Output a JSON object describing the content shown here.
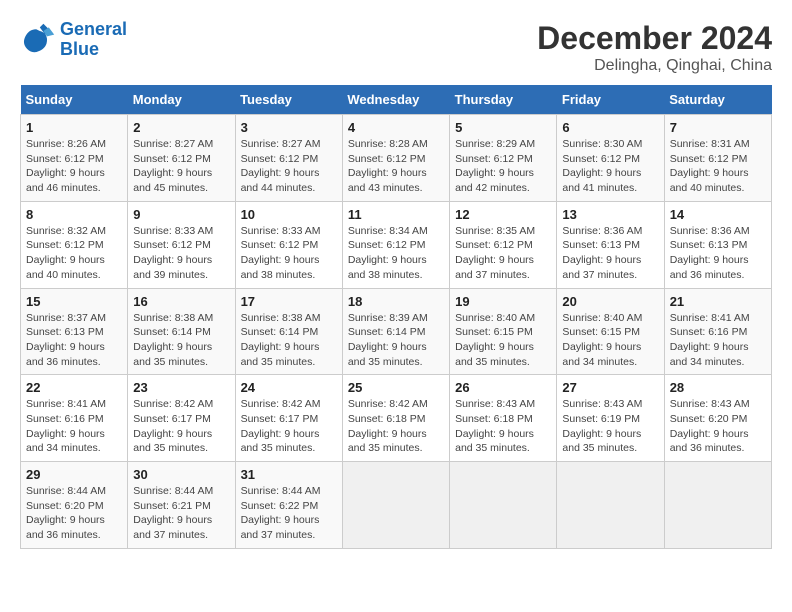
{
  "header": {
    "logo_line1": "General",
    "logo_line2": "Blue",
    "month": "December 2024",
    "location": "Delingha, Qinghai, China"
  },
  "weekdays": [
    "Sunday",
    "Monday",
    "Tuesday",
    "Wednesday",
    "Thursday",
    "Friday",
    "Saturday"
  ],
  "weeks": [
    [
      {
        "day": "1",
        "sunrise": "8:26 AM",
        "sunset": "6:12 PM",
        "daylight": "9 hours and 46 minutes."
      },
      {
        "day": "2",
        "sunrise": "8:27 AM",
        "sunset": "6:12 PM",
        "daylight": "9 hours and 45 minutes."
      },
      {
        "day": "3",
        "sunrise": "8:27 AM",
        "sunset": "6:12 PM",
        "daylight": "9 hours and 44 minutes."
      },
      {
        "day": "4",
        "sunrise": "8:28 AM",
        "sunset": "6:12 PM",
        "daylight": "9 hours and 43 minutes."
      },
      {
        "day": "5",
        "sunrise": "8:29 AM",
        "sunset": "6:12 PM",
        "daylight": "9 hours and 42 minutes."
      },
      {
        "day": "6",
        "sunrise": "8:30 AM",
        "sunset": "6:12 PM",
        "daylight": "9 hours and 41 minutes."
      },
      {
        "day": "7",
        "sunrise": "8:31 AM",
        "sunset": "6:12 PM",
        "daylight": "9 hours and 40 minutes."
      }
    ],
    [
      {
        "day": "8",
        "sunrise": "8:32 AM",
        "sunset": "6:12 PM",
        "daylight": "9 hours and 40 minutes."
      },
      {
        "day": "9",
        "sunrise": "8:33 AM",
        "sunset": "6:12 PM",
        "daylight": "9 hours and 39 minutes."
      },
      {
        "day": "10",
        "sunrise": "8:33 AM",
        "sunset": "6:12 PM",
        "daylight": "9 hours and 38 minutes."
      },
      {
        "day": "11",
        "sunrise": "8:34 AM",
        "sunset": "6:12 PM",
        "daylight": "9 hours and 38 minutes."
      },
      {
        "day": "12",
        "sunrise": "8:35 AM",
        "sunset": "6:12 PM",
        "daylight": "9 hours and 37 minutes."
      },
      {
        "day": "13",
        "sunrise": "8:36 AM",
        "sunset": "6:13 PM",
        "daylight": "9 hours and 37 minutes."
      },
      {
        "day": "14",
        "sunrise": "8:36 AM",
        "sunset": "6:13 PM",
        "daylight": "9 hours and 36 minutes."
      }
    ],
    [
      {
        "day": "15",
        "sunrise": "8:37 AM",
        "sunset": "6:13 PM",
        "daylight": "9 hours and 36 minutes."
      },
      {
        "day": "16",
        "sunrise": "8:38 AM",
        "sunset": "6:14 PM",
        "daylight": "9 hours and 35 minutes."
      },
      {
        "day": "17",
        "sunrise": "8:38 AM",
        "sunset": "6:14 PM",
        "daylight": "9 hours and 35 minutes."
      },
      {
        "day": "18",
        "sunrise": "8:39 AM",
        "sunset": "6:14 PM",
        "daylight": "9 hours and 35 minutes."
      },
      {
        "day": "19",
        "sunrise": "8:40 AM",
        "sunset": "6:15 PM",
        "daylight": "9 hours and 35 minutes."
      },
      {
        "day": "20",
        "sunrise": "8:40 AM",
        "sunset": "6:15 PM",
        "daylight": "9 hours and 34 minutes."
      },
      {
        "day": "21",
        "sunrise": "8:41 AM",
        "sunset": "6:16 PM",
        "daylight": "9 hours and 34 minutes."
      }
    ],
    [
      {
        "day": "22",
        "sunrise": "8:41 AM",
        "sunset": "6:16 PM",
        "daylight": "9 hours and 34 minutes."
      },
      {
        "day": "23",
        "sunrise": "8:42 AM",
        "sunset": "6:17 PM",
        "daylight": "9 hours and 35 minutes."
      },
      {
        "day": "24",
        "sunrise": "8:42 AM",
        "sunset": "6:17 PM",
        "daylight": "9 hours and 35 minutes."
      },
      {
        "day": "25",
        "sunrise": "8:42 AM",
        "sunset": "6:18 PM",
        "daylight": "9 hours and 35 minutes."
      },
      {
        "day": "26",
        "sunrise": "8:43 AM",
        "sunset": "6:18 PM",
        "daylight": "9 hours and 35 minutes."
      },
      {
        "day": "27",
        "sunrise": "8:43 AM",
        "sunset": "6:19 PM",
        "daylight": "9 hours and 35 minutes."
      },
      {
        "day": "28",
        "sunrise": "8:43 AM",
        "sunset": "6:20 PM",
        "daylight": "9 hours and 36 minutes."
      }
    ],
    [
      {
        "day": "29",
        "sunrise": "8:44 AM",
        "sunset": "6:20 PM",
        "daylight": "9 hours and 36 minutes."
      },
      {
        "day": "30",
        "sunrise": "8:44 AM",
        "sunset": "6:21 PM",
        "daylight": "9 hours and 37 minutes."
      },
      {
        "day": "31",
        "sunrise": "8:44 AM",
        "sunset": "6:22 PM",
        "daylight": "9 hours and 37 minutes."
      },
      null,
      null,
      null,
      null
    ]
  ]
}
